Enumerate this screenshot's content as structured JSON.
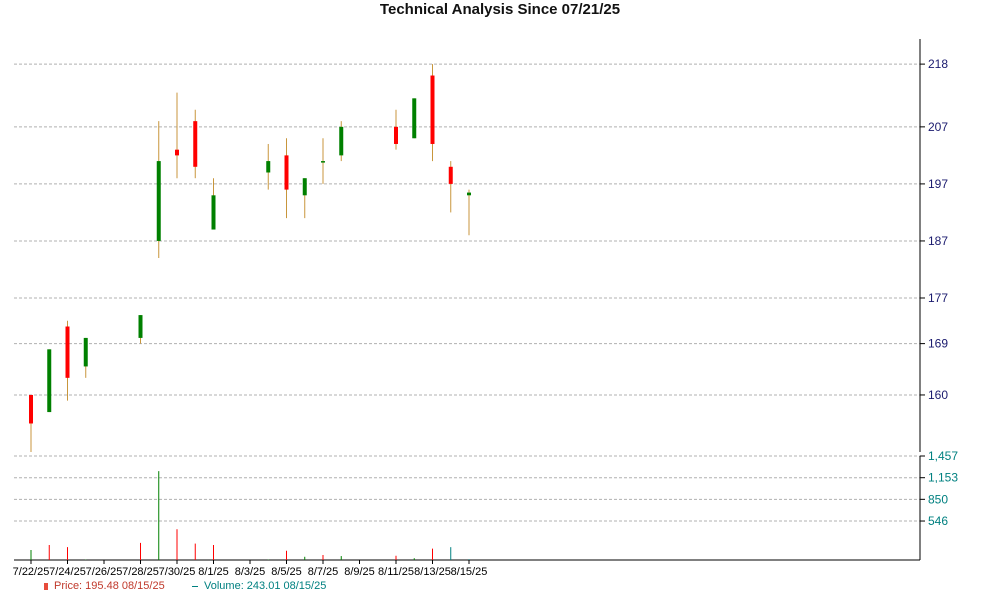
{
  "chart_data": [
    {
      "type": "candlestick",
      "title": "Technical Analysis Since 07/21/25",
      "ylim": [
        150,
        221
      ],
      "yticks": [
        160,
        169,
        177,
        187,
        197,
        207,
        218
      ],
      "xticks": [
        "7/22/25",
        "7/24/25",
        "7/26/25",
        "7/28/25",
        "7/30/25",
        "8/1/25",
        "8/3/25",
        "8/5/25",
        "8/7/25",
        "8/9/25",
        "8/11/25",
        "8/13/25",
        "8/15/25"
      ],
      "grid": true,
      "up_color": "#008000",
      "down_color": "#ff0000",
      "wick_color": "#c8963c",
      "candles": [
        {
          "date": "7/22/25",
          "open": 160,
          "high": 160,
          "low": 150,
          "close": 155
        },
        {
          "date": "7/23/25",
          "open": 157,
          "high": 168,
          "low": 157,
          "close": 168
        },
        {
          "date": "7/24/25",
          "open": 172,
          "high": 173,
          "low": 159,
          "close": 163
        },
        {
          "date": "7/25/25",
          "open": 165,
          "high": 170,
          "low": 163,
          "close": 170
        },
        {
          "date": "7/28/25",
          "open": 170,
          "high": 174,
          "low": 169,
          "close": 174
        },
        {
          "date": "7/29/25",
          "open": 187,
          "high": 208,
          "low": 184,
          "close": 201
        },
        {
          "date": "7/30/25",
          "open": 203,
          "high": 213,
          "low": 198,
          "close": 202
        },
        {
          "date": "7/31/25",
          "open": 208,
          "high": 210,
          "low": 198,
          "close": 200
        },
        {
          "date": "8/1/25",
          "open": 189,
          "high": 198,
          "low": 189,
          "close": 195
        },
        {
          "date": "8/4/25",
          "open": 199,
          "high": 204,
          "low": 196,
          "close": 201
        },
        {
          "date": "8/5/25",
          "open": 202,
          "high": 205,
          "low": 191,
          "close": 196
        },
        {
          "date": "8/6/25",
          "open": 195,
          "high": 198,
          "low": 191,
          "close": 198
        },
        {
          "date": "8/7/25",
          "open": 201,
          "high": 205,
          "low": 197,
          "close": 201
        },
        {
          "date": "8/8/25",
          "open": 202,
          "high": 208,
          "low": 201,
          "close": 207
        },
        {
          "date": "8/11/25",
          "open": 207,
          "high": 210,
          "low": 203,
          "close": 204
        },
        {
          "date": "8/12/25",
          "open": 205,
          "high": 212,
          "low": 205,
          "close": 212
        },
        {
          "date": "8/13/25",
          "open": 216,
          "high": 218,
          "low": 201,
          "close": 204
        },
        {
          "date": "8/14/25",
          "open": 200,
          "high": 201,
          "low": 192,
          "close": 197
        },
        {
          "date": "8/15/25",
          "open": 195,
          "high": 196,
          "low": 188,
          "close": 195.48
        }
      ]
    },
    {
      "type": "bar",
      "title": "",
      "ylim": [
        0,
        1457
      ],
      "yticks": [
        "546",
        "850",
        "1,153",
        "1,457"
      ],
      "ytick_values": [
        546,
        850,
        1153,
        1457
      ],
      "grid": true,
      "series": [
        {
          "name": "Volume",
          "values": [
            {
              "date": "7/22/25",
              "value": 140,
              "color": "#008000"
            },
            {
              "date": "7/23/25",
              "value": 210,
              "color": "#ff0000"
            },
            {
              "date": "7/24/25",
              "value": 180,
              "color": "#ff0000"
            },
            {
              "date": "7/25/25",
              "value": 6,
              "color": "#008000"
            },
            {
              "date": "7/28/25",
              "value": 240,
              "color": "#ff0000"
            },
            {
              "date": "7/29/25",
              "value": 1245,
              "color": "#008000"
            },
            {
              "date": "7/30/25",
              "value": 430,
              "color": "#ff0000"
            },
            {
              "date": "7/31/25",
              "value": 230,
              "color": "#ff0000"
            },
            {
              "date": "8/1/25",
              "value": 210,
              "color": "#ff0000"
            },
            {
              "date": "8/4/25",
              "value": 6,
              "color": "#008000"
            },
            {
              "date": "8/5/25",
              "value": 130,
              "color": "#ff0000"
            },
            {
              "date": "8/6/25",
              "value": 45,
              "color": "#008000"
            },
            {
              "date": "8/7/25",
              "value": 70,
              "color": "#ff0000"
            },
            {
              "date": "8/8/25",
              "value": 55,
              "color": "#008000"
            },
            {
              "date": "8/11/25",
              "value": 60,
              "color": "#ff0000"
            },
            {
              "date": "8/12/25",
              "value": 25,
              "color": "#008000"
            },
            {
              "date": "8/13/25",
              "value": 160,
              "color": "#ff0000"
            },
            {
              "date": "8/14/25",
              "value": 180,
              "color": "#008080"
            },
            {
              "date": "8/15/25",
              "value": 10,
              "color": "#008080"
            }
          ]
        }
      ]
    }
  ],
  "legend": {
    "price_label": "Price: 195.48  08/15/25",
    "price_color": "#c0392b",
    "volume_label": "Volume: 243.01  08/15/25",
    "volume_color": "#008080"
  }
}
